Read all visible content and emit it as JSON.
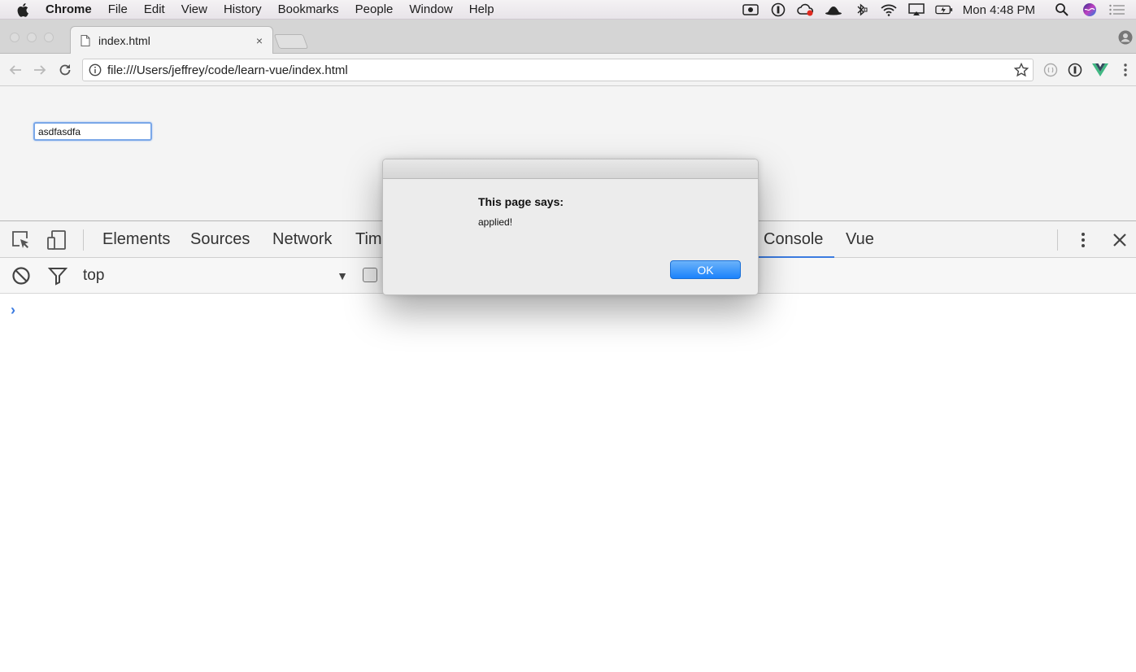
{
  "menubar": {
    "app_name": "Chrome",
    "items": [
      "File",
      "Edit",
      "View",
      "History",
      "Bookmarks",
      "People",
      "Window",
      "Help"
    ],
    "clock": "Mon 4:48 PM"
  },
  "browser": {
    "tab_title": "index.html",
    "tab_close": "×",
    "url": "file:///Users/jeffrey/code/learn-vue/index.html"
  },
  "page": {
    "input_value": "asdfasdfa"
  },
  "devtools": {
    "tabs": [
      "Elements",
      "Sources",
      "Network",
      "Tim",
      "Console",
      "Vue"
    ],
    "active_tab": "Console",
    "context": "top",
    "prompt": "›"
  },
  "dialog": {
    "heading": "This page says:",
    "message": "applied!",
    "ok_label": "OK"
  },
  "colors": {
    "accent": "#3b7be0",
    "ok_button": "#1a82fb"
  }
}
